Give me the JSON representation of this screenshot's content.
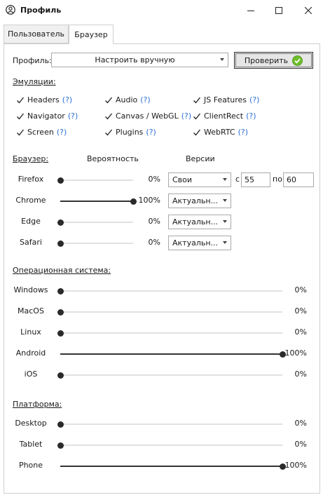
{
  "window": {
    "title": "Профиль"
  },
  "tabs": [
    {
      "label": "Пользователь",
      "active": false
    },
    {
      "label": "Браузер",
      "active": true
    }
  ],
  "profile": {
    "label": "Профиль:",
    "selected": "Настроить вручную",
    "check_button": "Проверить"
  },
  "emulation": {
    "label": "Эмуляции:",
    "help": "(?)",
    "items": [
      {
        "label": "Headers",
        "checked": true
      },
      {
        "label": "Audio",
        "checked": true
      },
      {
        "label": "JS Features",
        "checked": true
      },
      {
        "label": "Navigator",
        "checked": true
      },
      {
        "label": "Canvas / WebGL",
        "checked": true
      },
      {
        "label": "ClientRect",
        "checked": true
      },
      {
        "label": "Screen",
        "checked": true
      },
      {
        "label": "Plugins",
        "checked": true
      },
      {
        "label": "WebRTC",
        "checked": true
      }
    ]
  },
  "browser": {
    "label": "Браузер:",
    "probability_header": "Вероятность",
    "versions_header": "Версии",
    "rows": [
      {
        "name": "Firefox",
        "value": 0,
        "value_text": "0%",
        "version": "Свои",
        "from_label": "с",
        "from": "55",
        "to_label": "по",
        "to": "60"
      },
      {
        "name": "Chrome",
        "value": 100,
        "value_text": "100%",
        "version": "Актуальн..."
      },
      {
        "name": "Edge",
        "value": 0,
        "value_text": "0%",
        "version": "Актуальн..."
      },
      {
        "name": "Safari",
        "value": 0,
        "value_text": "0%",
        "version": "Актуальн..."
      }
    ]
  },
  "os": {
    "label": "Операционная система:",
    "rows": [
      {
        "name": "Windows",
        "value": 0,
        "value_text": "0%"
      },
      {
        "name": "MacOS",
        "value": 0,
        "value_text": "0%"
      },
      {
        "name": "Linux",
        "value": 0,
        "value_text": "0%"
      },
      {
        "name": "Android",
        "value": 100,
        "value_text": "100%"
      },
      {
        "name": "iOS",
        "value": 0,
        "value_text": "0%"
      }
    ]
  },
  "platform": {
    "label": "Платформа:",
    "rows": [
      {
        "name": "Desktop",
        "value": 0,
        "value_text": "0%"
      },
      {
        "name": "Tablet",
        "value": 0,
        "value_text": "0%"
      },
      {
        "name": "Phone",
        "value": 100,
        "value_text": "100%"
      }
    ]
  },
  "colors": {
    "accent_help": "#2a6fd6",
    "check_ok": "#6fbf2a",
    "slider_thumb": "#2a2a2a"
  }
}
